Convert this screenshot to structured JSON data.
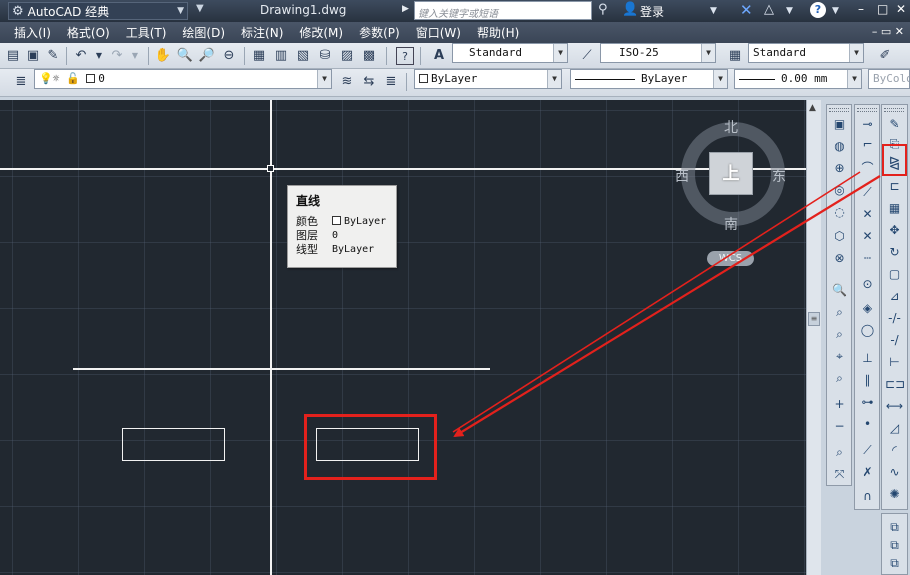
{
  "titlebar": {
    "workspace": "AutoCAD 经典",
    "document_title": "Drawing1.dwg",
    "search_placeholder": "键入关键字或短语",
    "login_label": "登录",
    "help_label": "?"
  },
  "menu": [
    "插入(I)",
    "格式(O)",
    "工具(T)",
    "绘图(D)",
    "标注(N)",
    "修改(M)",
    "参数(P)",
    "窗口(W)",
    "帮助(H)"
  ],
  "toolbar_styles": {
    "text_style": "Standard",
    "dim_style": "ISO-25",
    "table_style": "Standard"
  },
  "toolbar_layers": {
    "layer": "0",
    "color": "ByLayer",
    "linetype": "ByLayer",
    "lineweight": "0.00 mm",
    "plotstyle": "ByColor"
  },
  "tooltip": {
    "title": "直线",
    "rows": [
      {
        "key": "颜色",
        "value": "ByLayer"
      },
      {
        "key": "图层",
        "value": "0"
      },
      {
        "key": "线型",
        "value": "ByLayer"
      }
    ]
  },
  "viewcube": {
    "north": "北",
    "south": "南",
    "east": "东",
    "west": "西",
    "face": "上",
    "wcs": "WCS"
  },
  "colors": {
    "canvas_bg": "#212830",
    "annotation_red": "#e3211c",
    "geometry": "#f2f2f2"
  }
}
